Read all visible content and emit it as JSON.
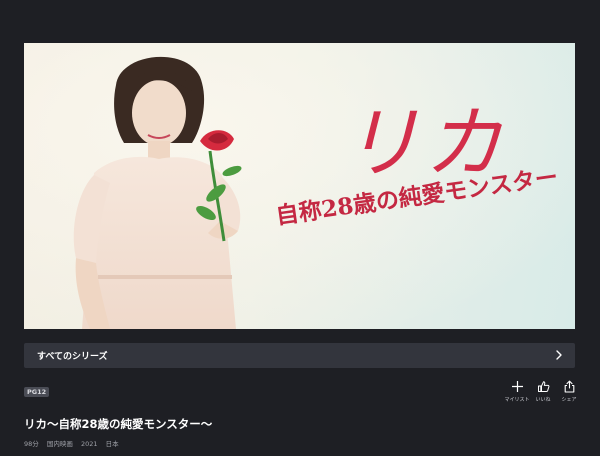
{
  "hero": {
    "title_main": "リカ",
    "title_sub": "自称28歳の純愛モンスター",
    "colors": {
      "title": "#d32e4a",
      "background": "#eef0e6"
    }
  },
  "series": {
    "label": "すべてのシリーズ",
    "icon": "chevron-right-icon"
  },
  "content": {
    "rating": "PG12",
    "title": "リカ〜自称28歳の純愛モンスター〜",
    "meta": {
      "duration": "98分",
      "genre": "国内映画",
      "year": "2021",
      "country": "日本"
    }
  },
  "actions": [
    {
      "label": "マイリスト",
      "icon": "plus-icon"
    },
    {
      "label": "いいね",
      "icon": "thumbs-up-icon"
    },
    {
      "label": "シェア",
      "icon": "share-icon"
    }
  ]
}
